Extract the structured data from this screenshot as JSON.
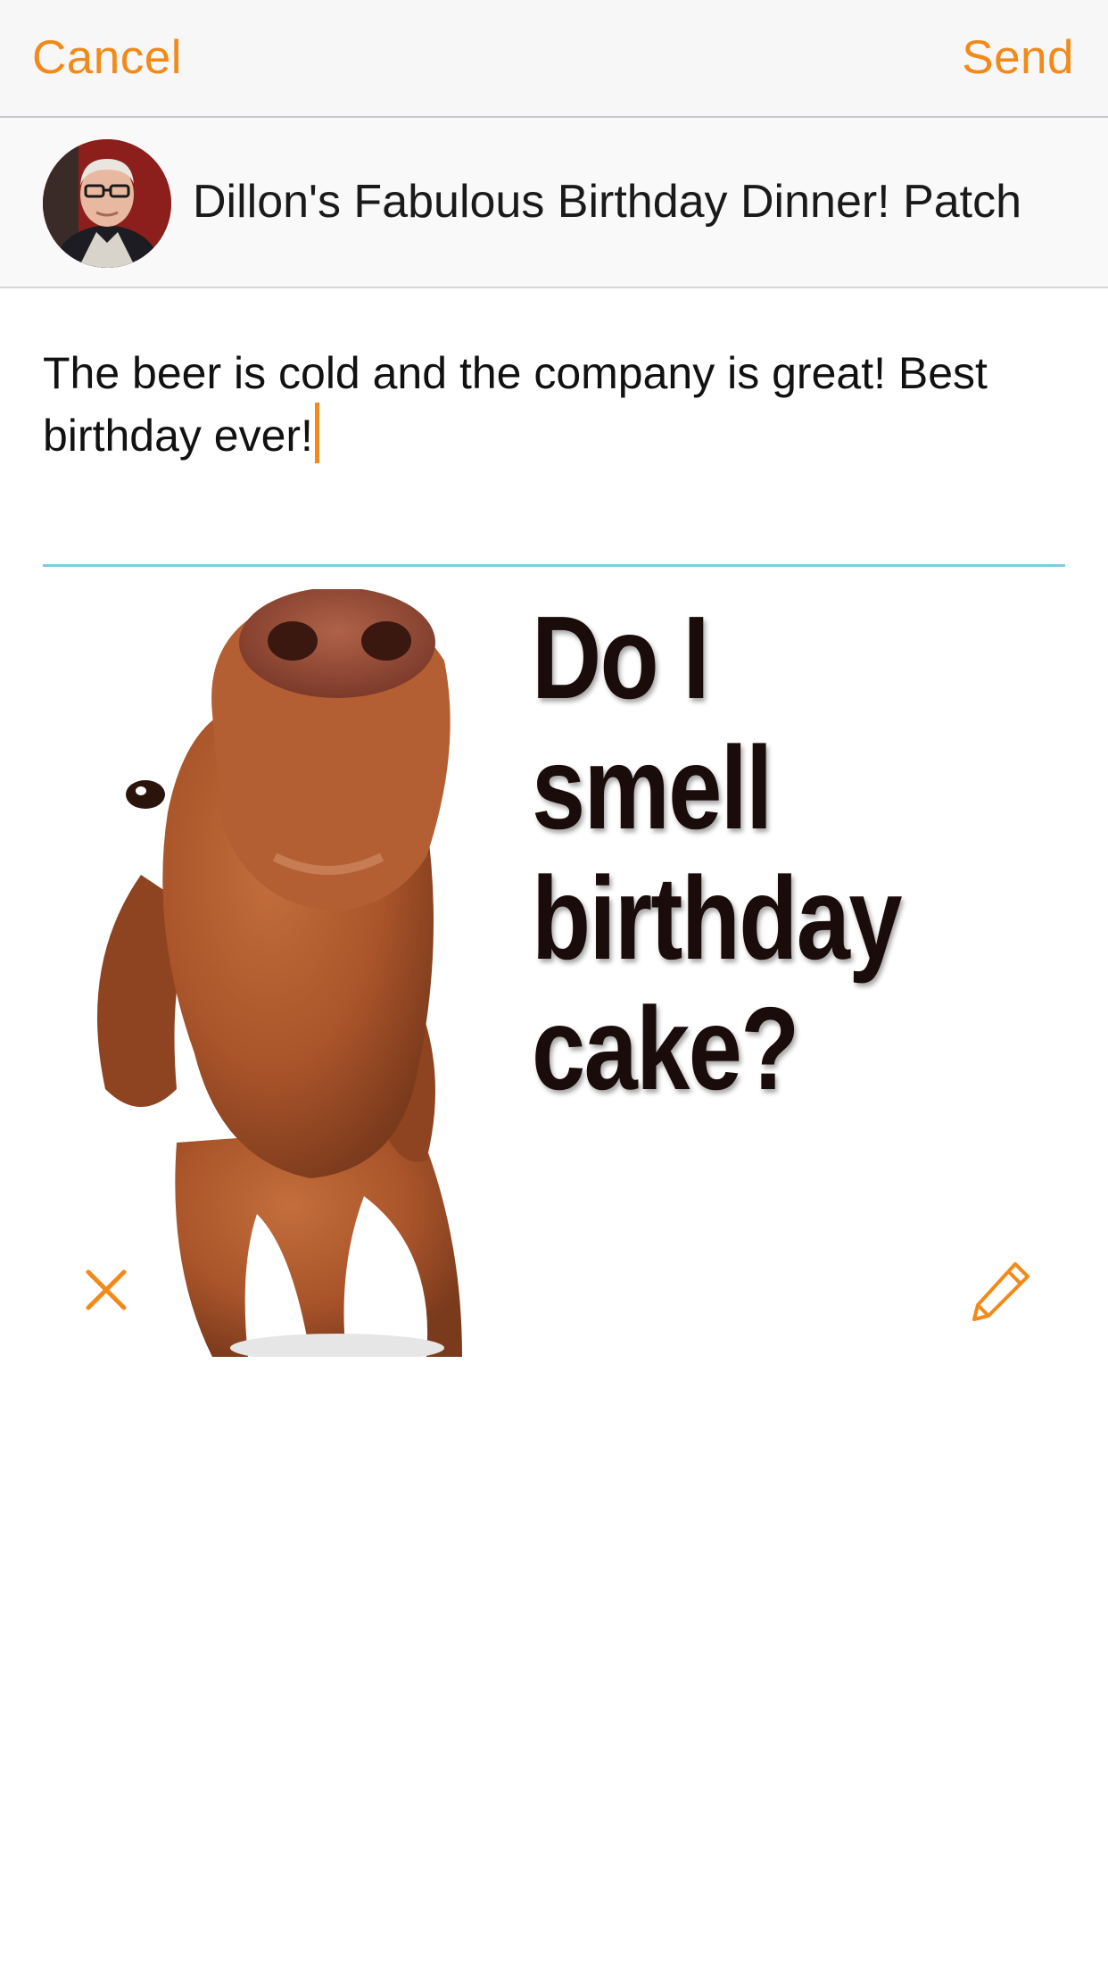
{
  "navbar": {
    "cancel_label": "Cancel",
    "send_label": "Send"
  },
  "patch": {
    "title": "Dillon's Fabulous Birthday Dinner! Patch",
    "avatar_icon": "user-avatar"
  },
  "composer": {
    "message": "The beer is cold and the company is great! Best birthday ever!"
  },
  "attachment": {
    "caption_lines": [
      "Do I smell",
      "birthday",
      "cake?"
    ],
    "remove_icon": "close-icon",
    "edit_icon": "pencil-icon"
  },
  "colors": {
    "accent": "#f28a1a",
    "divider": "#7ccbe3",
    "dog": "#a9542a"
  }
}
